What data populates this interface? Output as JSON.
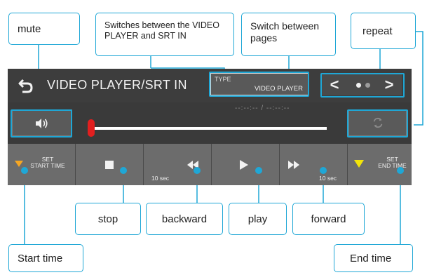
{
  "callouts": {
    "mute": "mute",
    "switches_desc": "Switches between the VIDEO PLAYER and SRT IN",
    "switch_pages": "Switch between pages",
    "repeat": "repeat",
    "stop": "stop",
    "backward": "backward",
    "play": "play",
    "forward": "forward",
    "start_time": "Start time",
    "end_time": "End time"
  },
  "titlebar": {
    "title": "VIDEO PLAYER/SRT IN",
    "type_label": "TYPE",
    "type_value": "VIDEO PLAYER",
    "page_prev": "<",
    "page_next": ">"
  },
  "player": {
    "time_display": "--:--:--  /  --:--:--",
    "position": 0.0
  },
  "controls": {
    "set_start": "SET\nSTART TIME",
    "backward_step": "10 sec",
    "forward_step": "10 sec",
    "set_end": "SET\nEND TIME"
  },
  "colors": {
    "accent": "#1fa7d6",
    "device_bg": "#3a3a3a",
    "button_bg": "#6c6c6c",
    "thumb": "#e21f1f",
    "start_marker": "#f5a623",
    "end_marker": "#f2e40a"
  },
  "icons": [
    "back-icon",
    "volume-icon",
    "repeat-icon",
    "stop-icon",
    "rewind-icon",
    "play-icon",
    "fast-forward-icon",
    "start-marker-icon",
    "end-marker-icon"
  ]
}
